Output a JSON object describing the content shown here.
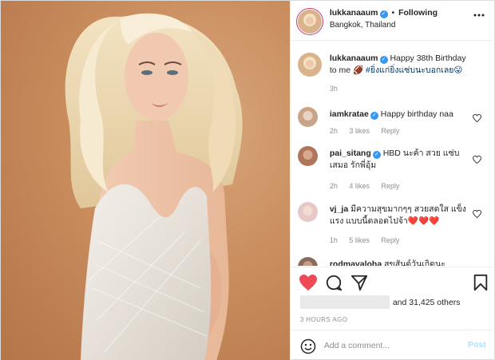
{
  "header": {
    "username": "lukkanaaum",
    "separator": "•",
    "follow_label": "Following",
    "location": "Bangkok, Thailand"
  },
  "caption": {
    "username": "lukkanaaum",
    "text": "Happy 38th Birthday to me 🏈",
    "hashtag": "#ยิ่งแก่ยิ่งแซ่บนะบอกเลย😛",
    "time": "3h"
  },
  "comments": [
    {
      "username": "iamkratae",
      "text": "Happy birthday naa",
      "time": "2h",
      "likes": "3 likes",
      "reply": "Reply"
    },
    {
      "username": "pai_sitang",
      "text": "HBD นะค้า สวย แซ่บ เสมอ รักพี่อุ้ม",
      "time": "2h",
      "likes": "4 likes",
      "reply": "Reply"
    },
    {
      "username": "vj_ja",
      "text": "มีความสุขมากๆๆ สวยสดใส แข็งแรง แบบนี้ตลอดไปจ้า❤️❤️❤️",
      "time": "1h",
      "likes": "5 likes",
      "reply": "Reply"
    },
    {
      "username": "rodmavaloha",
      "text": "สุขสันต์วันเกิดนะ",
      "time": "",
      "likes": "",
      "reply": ""
    }
  ],
  "likes": {
    "text": "and 31,425 others"
  },
  "timestamp": "3 HOURS AGO",
  "add_comment": {
    "placeholder": "Add a comment...",
    "post_label": "Post"
  },
  "icons": {
    "like": "heart-filled-icon",
    "comment": "comment-bubble-icon",
    "share": "paper-plane-icon",
    "save": "bookmark-icon",
    "more": "more-options-icon",
    "emoji": "emoji-icon"
  },
  "colors": {
    "like_heart": "#ed4956",
    "verified": "#3897f0",
    "post_disabled": "#b2dffc"
  }
}
